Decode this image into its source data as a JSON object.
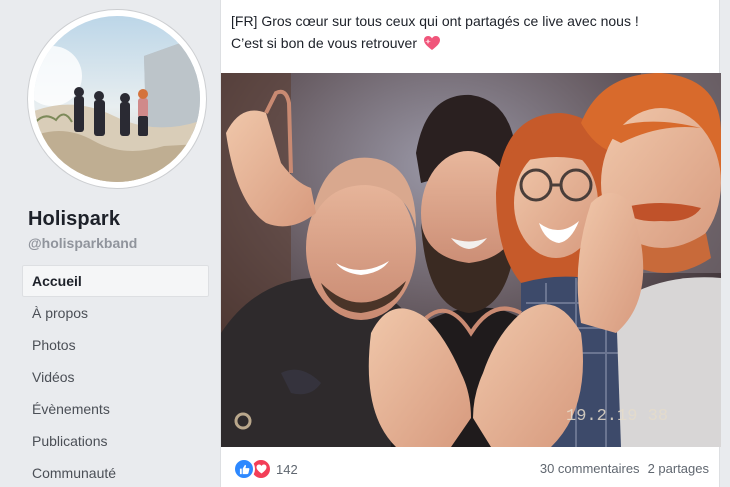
{
  "page": {
    "name": "Holispark",
    "handle": "@holisparkband"
  },
  "nav": {
    "items": [
      {
        "label": "Accueil",
        "active": true
      },
      {
        "label": "À propos",
        "active": false
      },
      {
        "label": "Photos",
        "active": false
      },
      {
        "label": "Vidéos",
        "active": false
      },
      {
        "label": "Évènements",
        "active": false
      },
      {
        "label": "Publications",
        "active": false
      },
      {
        "label": "Communauté",
        "active": false
      }
    ]
  },
  "post": {
    "line1": "[FR] Gros cœur sur tous ceux qui ont partagés ce live avec nous !",
    "line2": "C’est si bon de vous retrouver",
    "emoji": "sparkling-heart-icon",
    "photo_timestamp": "19.2.19 38"
  },
  "footer": {
    "reaction_icons": [
      "like-icon",
      "love-icon"
    ],
    "reaction_count": "142",
    "comments": "30 commentaires",
    "shares": "2 partages"
  },
  "colors": {
    "background": "#e9ebee",
    "like": "#2d88ff",
    "love": "#f33e58",
    "muted": "#90949c"
  }
}
